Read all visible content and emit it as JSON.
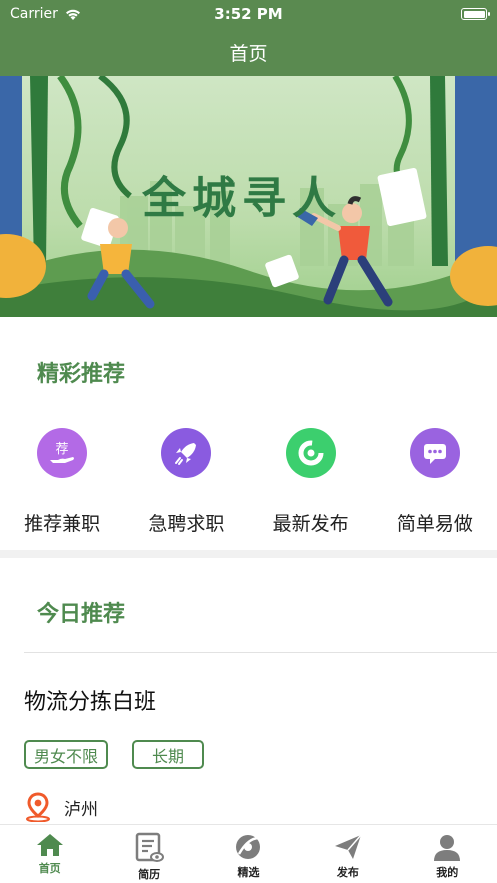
{
  "status_bar": {
    "carrier": "Carrier",
    "time": "3:52 PM"
  },
  "nav": {
    "title": "首页"
  },
  "banner": {
    "headline": "全城寻人"
  },
  "featured": {
    "title": "精彩推荐",
    "items": [
      {
        "label": "推荐兼职",
        "icon": "recommend-hand-icon",
        "color": "#b36ae6"
      },
      {
        "label": "急聘求职",
        "icon": "rocket-icon",
        "color": "#8a5be0"
      },
      {
        "label": "最新发布",
        "icon": "refresh-circle-icon",
        "color": "#3ccf6e"
      },
      {
        "label": "简单易做",
        "icon": "chat-bubble-icon",
        "color": "#9a63e0"
      }
    ]
  },
  "today": {
    "title": "今日推荐",
    "job": {
      "title": "物流分拣白班",
      "tags": [
        "男女不限",
        "长期"
      ],
      "location": "泸州"
    }
  },
  "tabbar": {
    "tabs": [
      {
        "label": "首页",
        "icon": "home-icon",
        "active": true
      },
      {
        "label": "简历",
        "icon": "resume-icon",
        "active": false
      },
      {
        "label": "精选",
        "icon": "featured-icon",
        "active": false
      },
      {
        "label": "发布",
        "icon": "send-icon",
        "active": false
      },
      {
        "label": "我的",
        "icon": "profile-icon",
        "active": false
      }
    ],
    "active_color": "#4f8a4f",
    "inactive_color": "#7d7d7d"
  }
}
